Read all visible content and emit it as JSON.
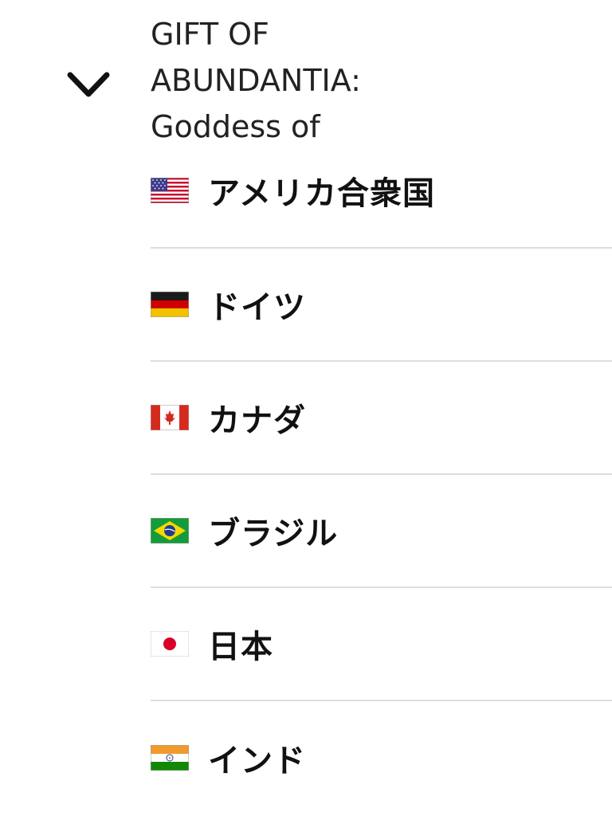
{
  "product": {
    "title_lines": [
      "GIFT OF",
      "ABUNDANTIA:",
      "Goddess of"
    ]
  },
  "expand_icon": "chevron-down-icon",
  "countries": [
    {
      "name": "アメリカ合衆国",
      "flag": "us-flag-icon"
    },
    {
      "name": "ドイツ",
      "flag": "germany-flag-icon"
    },
    {
      "name": "カナダ",
      "flag": "canada-flag-icon"
    },
    {
      "name": "ブラジル",
      "flag": "brazil-flag-icon"
    },
    {
      "name": "日本",
      "flag": "japan-flag-icon"
    },
    {
      "name": "インド",
      "flag": "india-flag-icon"
    }
  ],
  "colors": {
    "text": "#111111",
    "divider": "#dddddd",
    "background": "#ffffff"
  }
}
